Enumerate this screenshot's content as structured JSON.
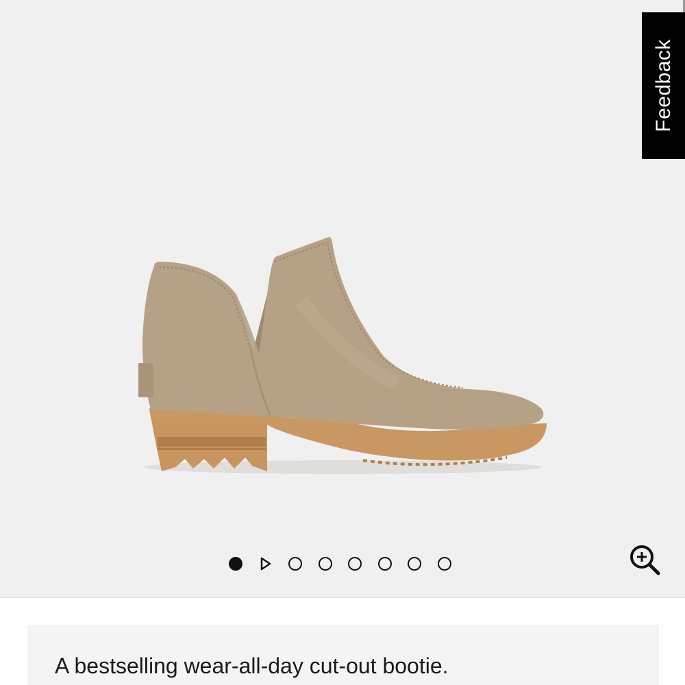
{
  "feedback": {
    "label": "Feedback"
  },
  "gallery": {
    "image_alt": "Tan suede cut-out ankle bootie with gum sole",
    "slide_count": 7,
    "active_slide": 1,
    "dots_icon": "circle-dot",
    "play_icon": "play-icon",
    "zoom_icon": "zoom-in-icon"
  },
  "product": {
    "description": "A bestselling wear-all-day cut-out bootie."
  },
  "colors": {
    "gallery_bg": "#f0f0f0",
    "suede": "#b4a185",
    "sole": "#c79660",
    "feedback_bg": "#000000"
  }
}
